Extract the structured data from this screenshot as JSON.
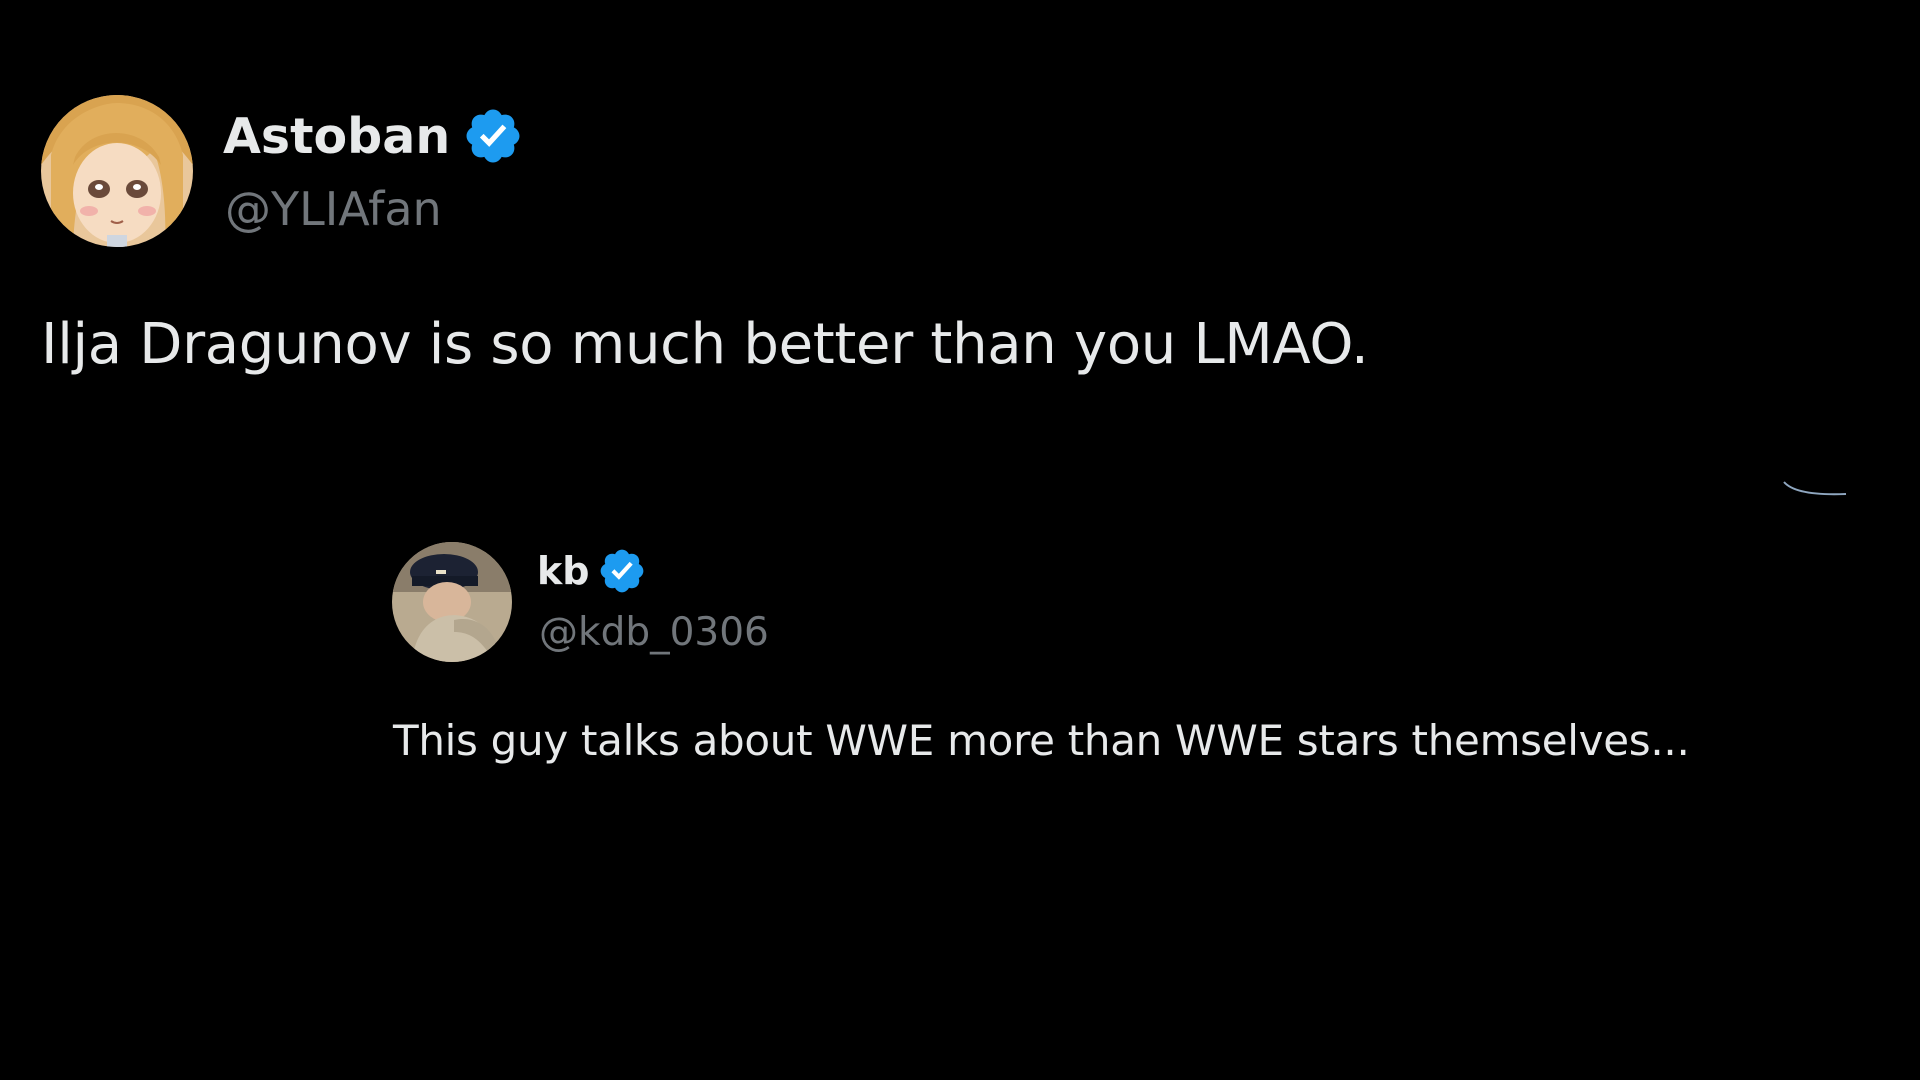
{
  "main_tweet": {
    "display_name": "Astoban",
    "handle": "@YLIAfan",
    "text": "Ilja Dragunov is so much better than you LMAO.",
    "verified": true,
    "avatar_icon": "anime-character-avatar"
  },
  "quoted_tweet": {
    "display_name": "kb",
    "handle": "@kdb_0306",
    "text": "This guy talks about WWE more than WWE stars themselves...",
    "verified": true,
    "avatar_icon": "person-in-cap-avatar"
  },
  "colors": {
    "background": "#000000",
    "primary_text": "#e7e9ea",
    "secondary_text": "#71767b",
    "verified_badge": "#1d9bf0"
  }
}
